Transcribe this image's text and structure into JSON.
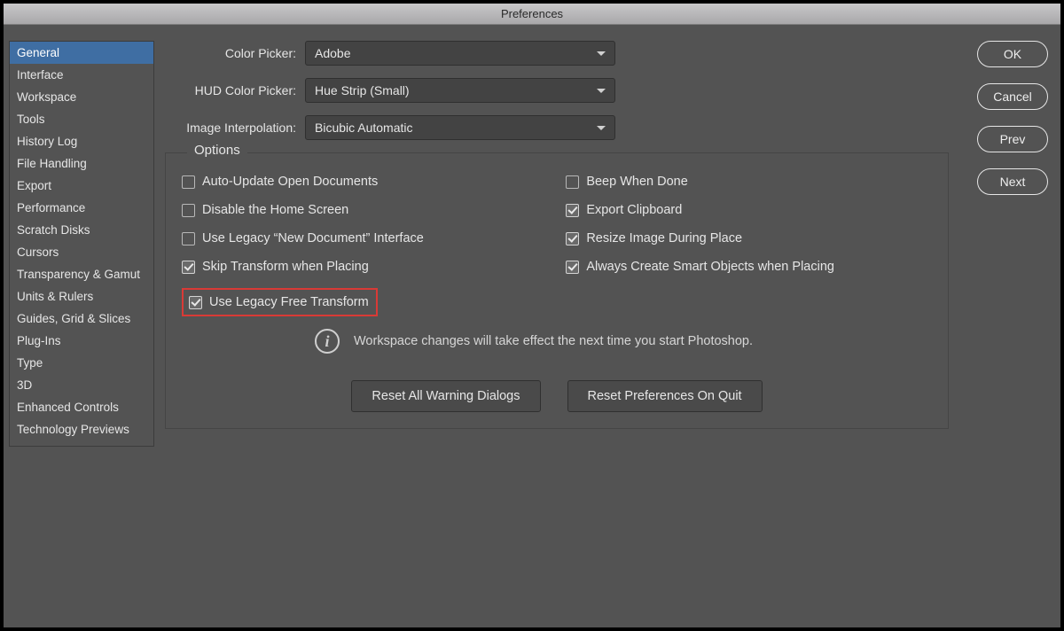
{
  "window": {
    "title": "Preferences"
  },
  "sidebar": {
    "items": [
      "General",
      "Interface",
      "Workspace",
      "Tools",
      "History Log",
      "File Handling",
      "Export",
      "Performance",
      "Scratch Disks",
      "Cursors",
      "Transparency & Gamut",
      "Units & Rulers",
      "Guides, Grid & Slices",
      "Plug-Ins",
      "Type",
      "3D",
      "Enhanced Controls",
      "Technology Previews"
    ],
    "selected_index": 0
  },
  "form": {
    "color_picker": {
      "label": "Color Picker:",
      "value": "Adobe"
    },
    "hud_picker": {
      "label": "HUD Color Picker:",
      "value": "Hue Strip (Small)"
    },
    "interp": {
      "label": "Image Interpolation:",
      "value": "Bicubic Automatic"
    }
  },
  "options": {
    "legend": "Options",
    "left": [
      {
        "label": "Auto-Update Open Documents",
        "checked": false
      },
      {
        "label": "Disable the Home Screen",
        "checked": false
      },
      {
        "label": "Use Legacy “New Document” Interface",
        "checked": false
      },
      {
        "label": "Skip Transform when Placing",
        "checked": true
      },
      {
        "label": "Use Legacy Free Transform",
        "checked": true,
        "highlight": true
      }
    ],
    "right": [
      {
        "label": "Beep When Done",
        "checked": false
      },
      {
        "label": "Export Clipboard",
        "checked": true
      },
      {
        "label": "Resize Image During Place",
        "checked": true
      },
      {
        "label": "Always Create Smart Objects when Placing",
        "checked": true
      }
    ],
    "info": "Workspace changes will take effect the next time you start Photoshop.",
    "reset_warnings": "Reset All Warning Dialogs",
    "reset_prefs": "Reset Preferences On Quit"
  },
  "buttons": {
    "ok": "OK",
    "cancel": "Cancel",
    "prev": "Prev",
    "next": "Next"
  }
}
